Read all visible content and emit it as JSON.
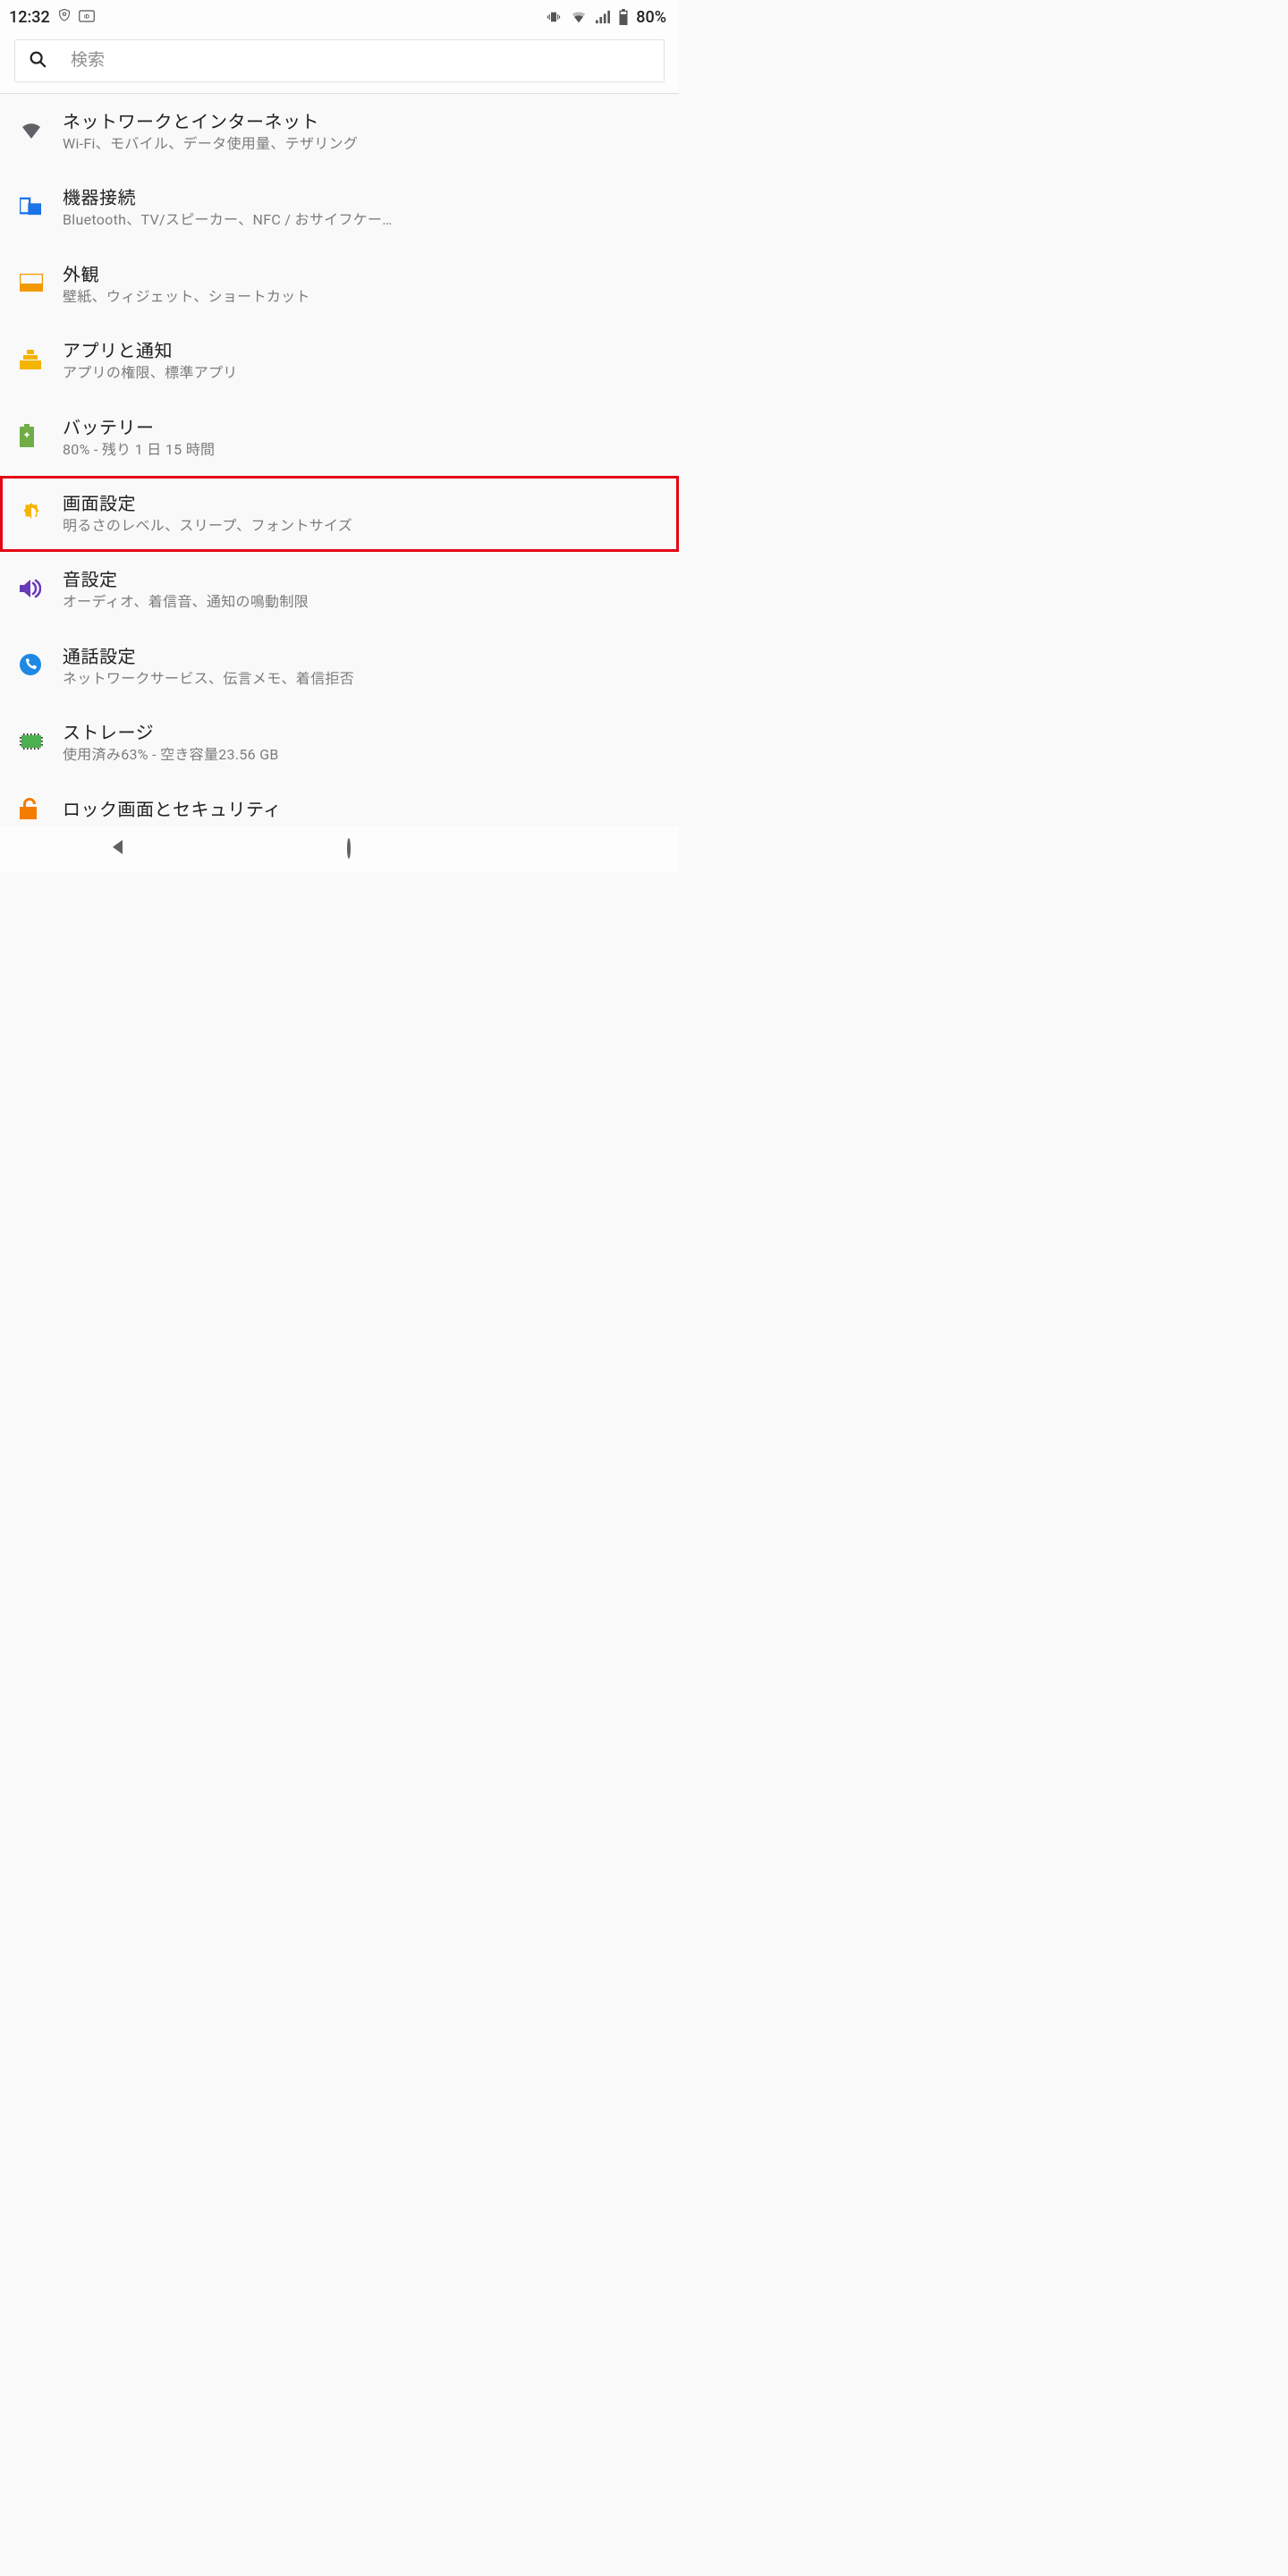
{
  "status": {
    "time": "12:32",
    "battery_text": "80%"
  },
  "search": {
    "placeholder": "検索"
  },
  "items": [
    {
      "title": "ネットワークとインターネット",
      "sub": "Wi-Fi、モバイル、データ使用量、テザリング"
    },
    {
      "title": "機器接続",
      "sub": "Bluetooth、TV/スピーカー、NFC / おサイフケー…"
    },
    {
      "title": "外観",
      "sub": "壁紙、ウィジェット、ショートカット"
    },
    {
      "title": "アプリと通知",
      "sub": "アプリの権限、標準アプリ"
    },
    {
      "title": "バッテリー",
      "sub": "80% - 残り 1 日 15 時間"
    },
    {
      "title": "画面設定",
      "sub": "明るさのレベル、スリープ、フォントサイズ"
    },
    {
      "title": "音設定",
      "sub": "オーディオ、着信音、通知の鳴動制限"
    },
    {
      "title": "通話設定",
      "sub": "ネットワークサービス、伝言メモ、着信拒否"
    },
    {
      "title": "ストレージ",
      "sub": "使用済み63% - 空き容量23.56 GB"
    },
    {
      "title": "ロック画面とセキュリティ",
      "sub": ""
    }
  ],
  "highlight_index": 5
}
